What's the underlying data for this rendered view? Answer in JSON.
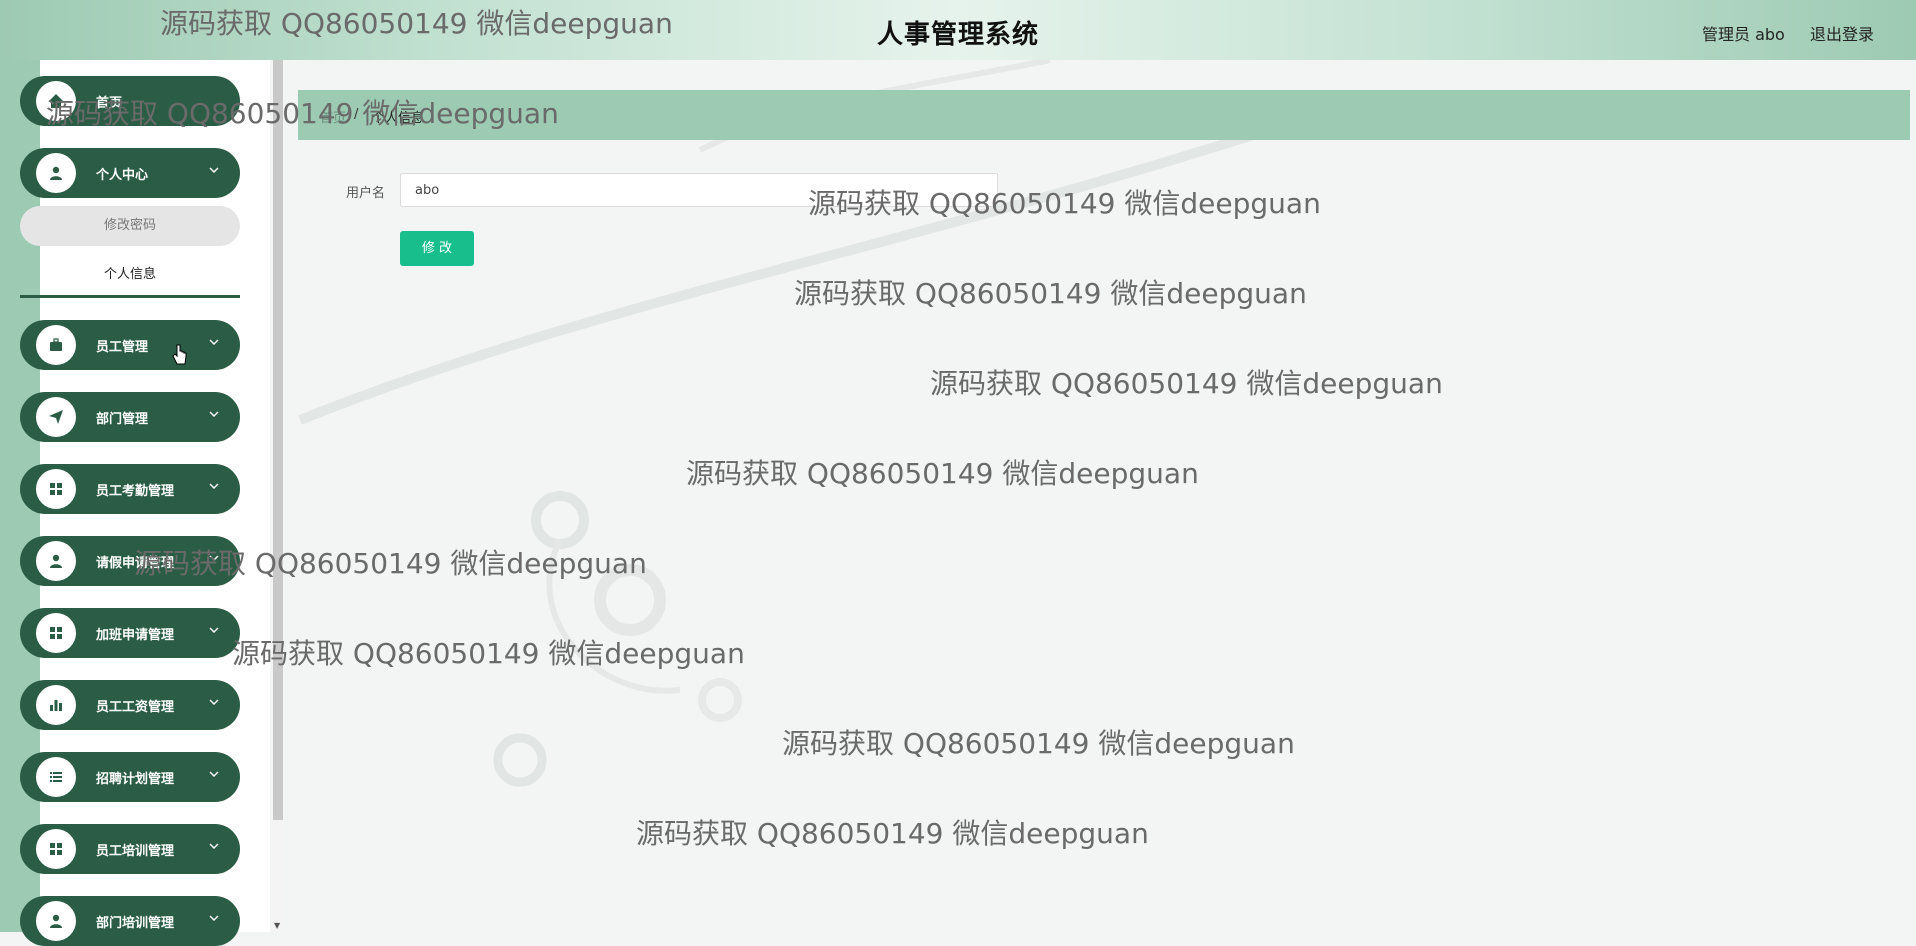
{
  "header": {
    "title": "人事管理系统",
    "admin_text": "管理员 abo",
    "logout_label": "退出登录"
  },
  "sidebar": {
    "items": [
      {
        "label": "首页",
        "icon": "home-icon"
      },
      {
        "label": "个人中心",
        "icon": "user-icon"
      },
      {
        "label": "员工管理",
        "icon": "briefcase-icon"
      },
      {
        "label": "部门管理",
        "icon": "send-icon"
      },
      {
        "label": "员工考勤管理",
        "icon": "grid-icon"
      },
      {
        "label": "请假申请管理",
        "icon": "user-icon"
      },
      {
        "label": "加班申请管理",
        "icon": "grid-icon"
      },
      {
        "label": "员工工资管理",
        "icon": "bar-chart-icon"
      },
      {
        "label": "招聘计划管理",
        "icon": "list-icon"
      },
      {
        "label": "员工培训管理",
        "icon": "grid-icon"
      },
      {
        "label": "部门培训管理",
        "icon": "user-icon"
      }
    ],
    "submenu": {
      "change_password": "修改密码",
      "personal_info": "个人信息"
    }
  },
  "breadcrumb": {
    "home": "首页",
    "separator": "/",
    "current": "个人信息"
  },
  "form": {
    "username_label": "用户名",
    "username_value": "abo",
    "submit_label": "修 改"
  },
  "watermark": "源码获取 QQ86050149 微信deepguan",
  "colors": {
    "sidebar_item": "#2b5d46",
    "accent_bar": "#9dcab3",
    "button": "#18be8c"
  }
}
